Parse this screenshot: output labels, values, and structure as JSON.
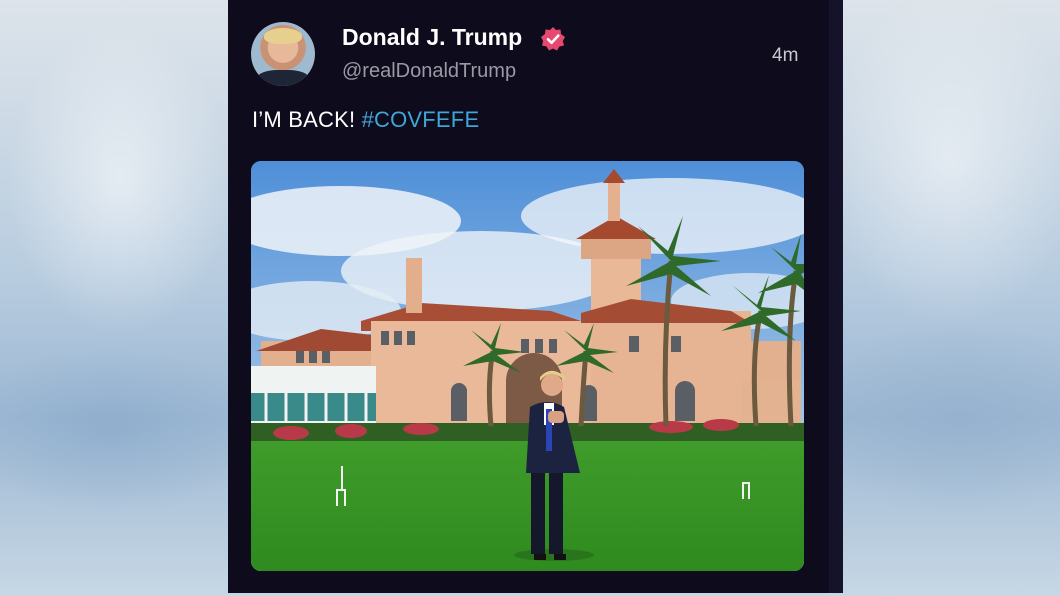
{
  "post": {
    "author_name": "Donald J. Trump",
    "author_handle": "@realDonaldTrump",
    "timestamp": "4m",
    "text": "I’M BACK! ",
    "hashtag": "#COVFEFE"
  },
  "colors": {
    "card_background": "#0d0b1c",
    "verified_badge": "#e8486f",
    "hashtag": "#3fa6d8",
    "handle": "#9a9aa6"
  },
  "icons": {
    "verified": "verified-badge-icon"
  }
}
